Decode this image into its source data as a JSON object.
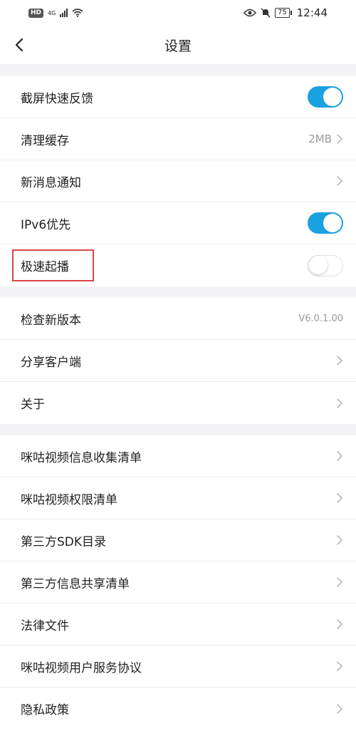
{
  "status_bar": {
    "hd": "HD",
    "network": "4G",
    "battery": "75",
    "time": "12:44"
  },
  "nav": {
    "title": "设置"
  },
  "groups": [
    {
      "rows": [
        {
          "id": "screenshot-feedback",
          "label": "截屏快速反馈",
          "control": "toggle",
          "state": "on"
        },
        {
          "id": "clear-cache",
          "label": "清理缓存",
          "control": "value-chevron",
          "value": "2MB"
        },
        {
          "id": "new-message-notify",
          "label": "新消息通知",
          "control": "chevron"
        },
        {
          "id": "ipv6-priority",
          "label": "IPv6优先",
          "control": "toggle",
          "state": "on"
        },
        {
          "id": "fast-start-play",
          "label": "极速起播",
          "control": "toggle",
          "state": "off",
          "highlighted": true
        }
      ]
    },
    {
      "rows": [
        {
          "id": "check-version",
          "label": "检查新版本",
          "control": "value",
          "value": "V6.0.1.00"
        },
        {
          "id": "share-client",
          "label": "分享客户端",
          "control": "chevron"
        },
        {
          "id": "about",
          "label": "关于",
          "control": "chevron"
        }
      ]
    },
    {
      "rows": [
        {
          "id": "info-collection-list",
          "label": "咪咕视频信息收集清单",
          "control": "chevron"
        },
        {
          "id": "permission-list",
          "label": "咪咕视频权限清单",
          "control": "chevron"
        },
        {
          "id": "third-party-sdk",
          "label": "第三方SDK目录",
          "control": "chevron"
        },
        {
          "id": "third-party-share",
          "label": "第三方信息共享清单",
          "control": "chevron"
        },
        {
          "id": "legal-docs",
          "label": "法律文件",
          "control": "chevron"
        },
        {
          "id": "user-agreement",
          "label": "咪咕视频用户服务协议",
          "control": "chevron"
        },
        {
          "id": "privacy-policy",
          "label": "隐私政策",
          "control": "chevron"
        }
      ]
    }
  ],
  "colors": {
    "toggle_on": "#1aa1e0",
    "highlight": "#d94545",
    "section_gap": "#f4f4f6"
  }
}
